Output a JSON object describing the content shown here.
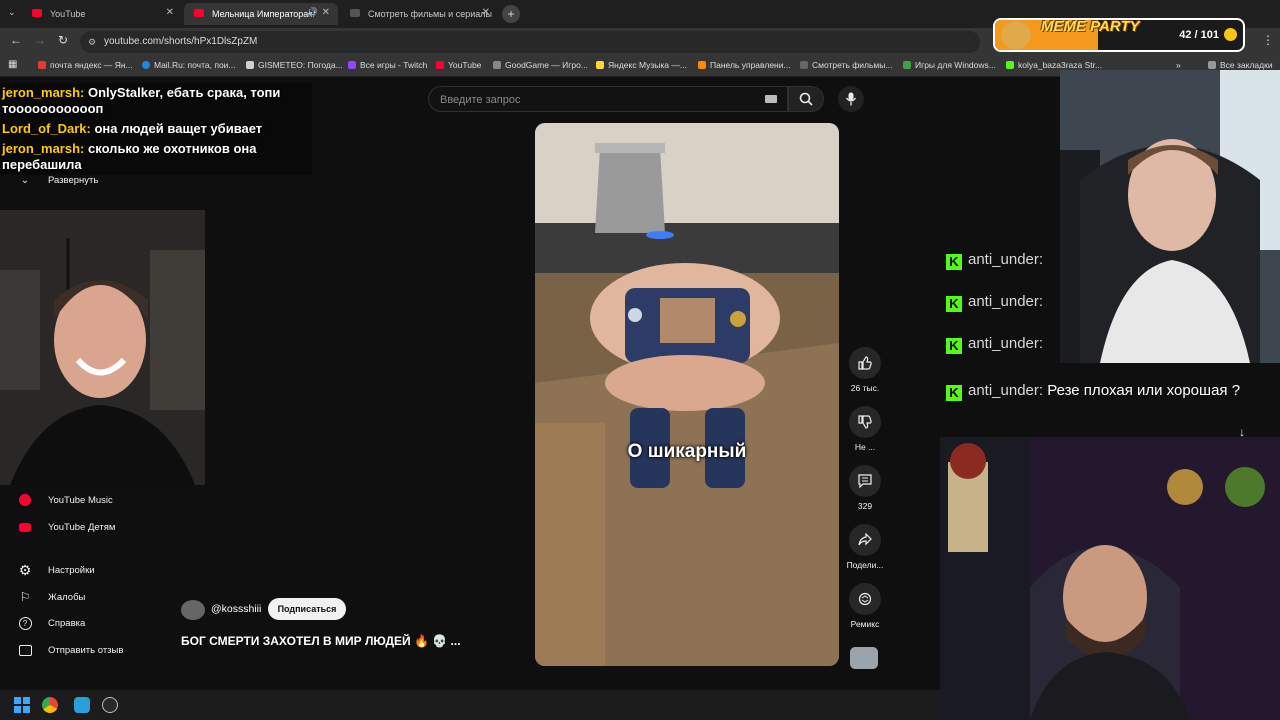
{
  "browser": {
    "tabs": [
      {
        "title": "YouTube",
        "active": false
      },
      {
        "title": "Мельница Императора #",
        "active": true
      },
      {
        "title": "Смотреть фильмы и сериалы",
        "active": false
      }
    ],
    "url": "youtube.com/shorts/hPx1DlsZpZM",
    "bookmarks": [
      "почта яндекс — Ян...",
      "Mail.Ru: почта, пои...",
      "GISMETEO: Погода...",
      "Все игры - Twitch",
      "YouTube",
      "GoodGame — Игро...",
      "Яндекс Музыка —...",
      "Панель управлени...",
      "Смотреть фильмы...",
      "Игры для Windows...",
      "kolya_baza3raza Str..."
    ],
    "all_bookmarks": "Все закладки"
  },
  "youtube": {
    "search_placeholder": "Введите запрос",
    "sidebar_expand": "Развернуть",
    "sidebar_items": [
      {
        "label": "YouTube Music",
        "icon": "youtube-music-icon"
      },
      {
        "label": "YouTube Детям",
        "icon": "youtube-kids-icon"
      },
      {
        "label": "Настройки",
        "icon": "gear-icon"
      },
      {
        "label": "Жалобы",
        "icon": "flag-icon"
      },
      {
        "label": "Справка",
        "icon": "help-icon"
      },
      {
        "label": "Отправить отзыв",
        "icon": "feedback-icon"
      }
    ],
    "short": {
      "caption": "О шикарный",
      "channel": "@kossshiii",
      "subscribe": "Подписаться",
      "title": "БОГ СМЕРТИ ЗАХОТЕЛ В МИР ЛЮДЕЙ 🔥 💀 ..."
    },
    "actions": {
      "likes": "26 тыс.",
      "dislike": "Не ...",
      "comments": "329",
      "share": "Подели...",
      "remix": "Ремикс"
    }
  },
  "chat_overlay": [
    {
      "nick": "jeron_marsh:",
      "text": "OnlyStalker, ебать срака, топи тоооооооооооп"
    },
    {
      "nick": "Lord_of_Dark:",
      "text": "она людей ващет убивает"
    },
    {
      "nick": "jeron_marsh:",
      "text": "сколько же охотников она перебашила"
    }
  ],
  "kick_chat": [
    {
      "user": "anti_under:",
      "text": ""
    },
    {
      "user": "anti_under:",
      "text": ""
    },
    {
      "user": "anti_under:",
      "text": ""
    },
    {
      "user": "anti_under:",
      "text": "Резе плохая или хорошая ?"
    }
  ],
  "meme_party": {
    "title": "MEME PARTY",
    "count": "42 / 101",
    "progress": 0.416
  },
  "colors": {
    "kick": "#53fc18",
    "youtube_red": "#ff0033",
    "accent": "#f39a1e"
  }
}
